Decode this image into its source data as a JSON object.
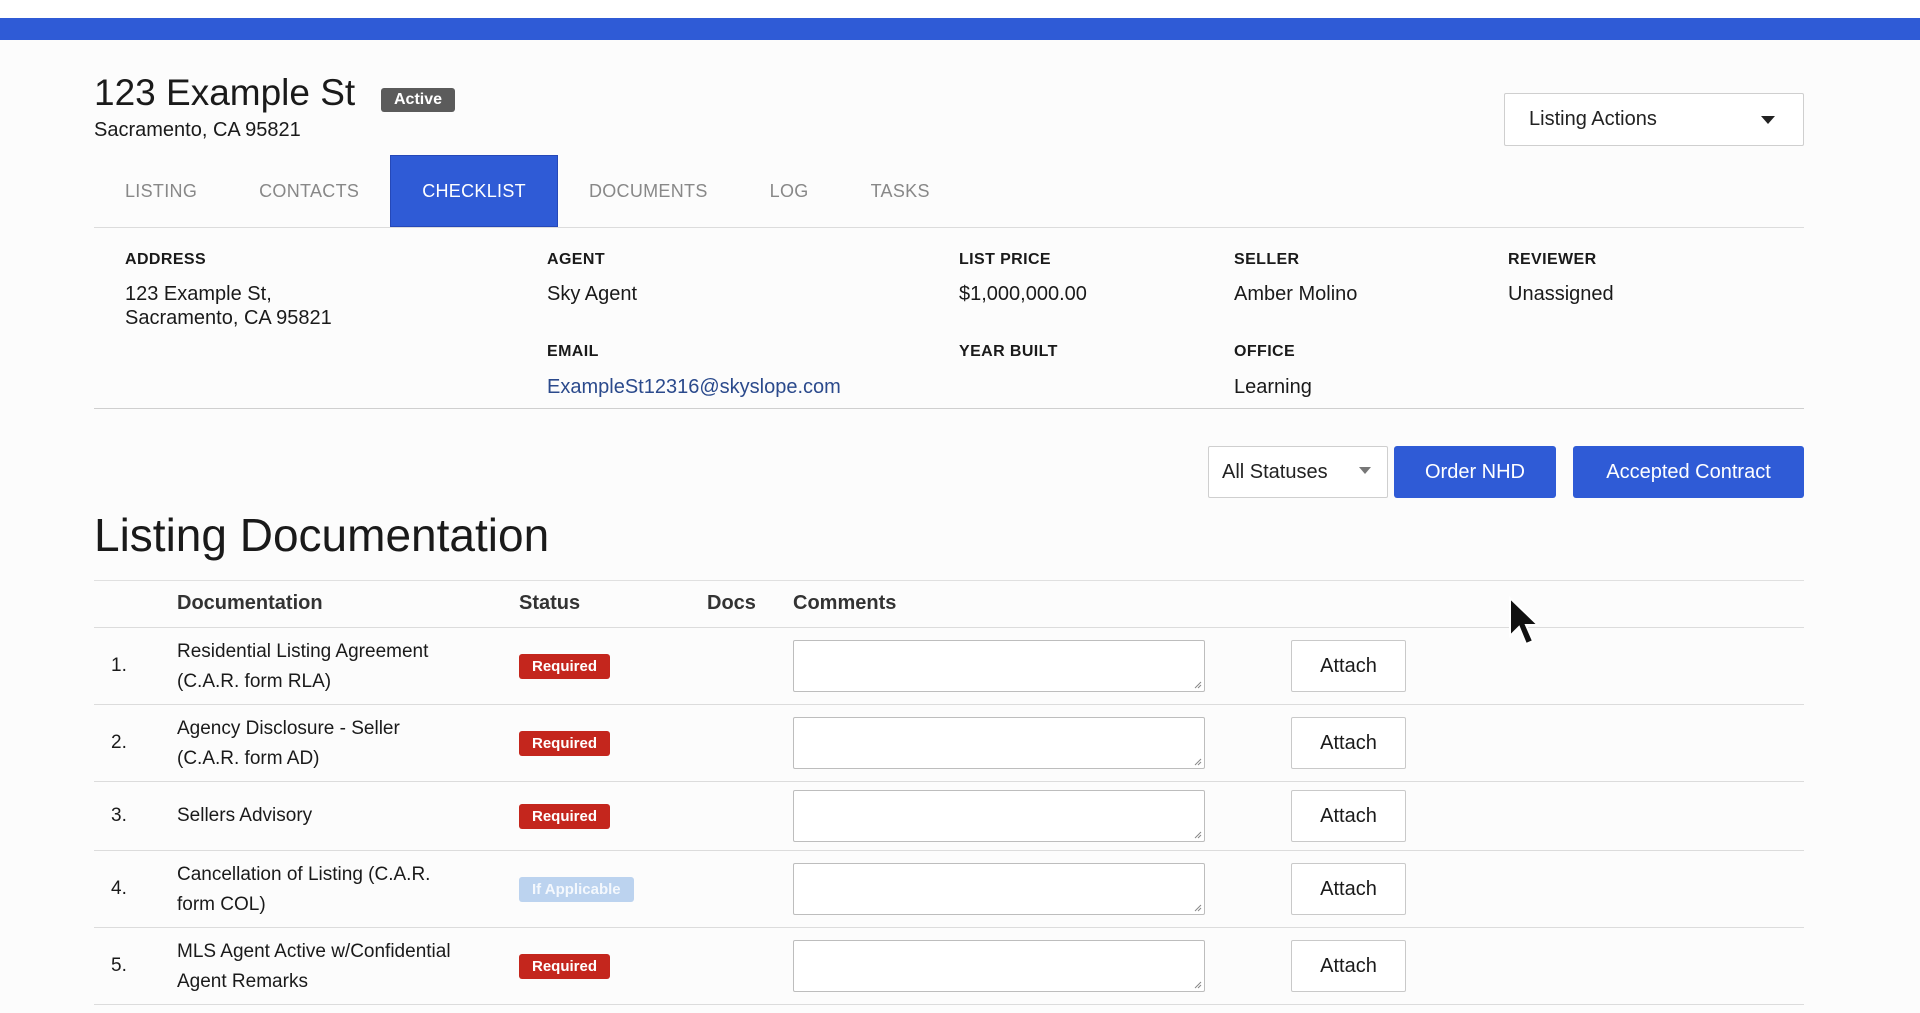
{
  "header": {
    "title": "123 Example St",
    "status_badge": "Active",
    "subaddress": "Sacramento, CA 95821",
    "actions_label": "Listing Actions"
  },
  "tabs": [
    {
      "label": "LISTING",
      "active": false
    },
    {
      "label": "CONTACTS",
      "active": false
    },
    {
      "label": "CHECKLIST",
      "active": true
    },
    {
      "label": "DOCUMENTS",
      "active": false
    },
    {
      "label": "LOG",
      "active": false
    },
    {
      "label": "TASKS",
      "active": false
    }
  ],
  "info": {
    "address_label": "ADDRESS",
    "address_line1": "123 Example St,",
    "address_line2": "Sacramento, CA 95821",
    "agent_label": "AGENT",
    "agent_value": "Sky Agent",
    "email_label": "EMAIL",
    "email_value": "ExampleSt12316@skyslope.com",
    "list_price_label": "LIST PRICE",
    "list_price_value": "$1,000,000.00",
    "year_built_label": "YEAR BUILT",
    "seller_label": "SELLER",
    "seller_value": "Amber Molino",
    "office_label": "OFFICE",
    "office_value": "Learning",
    "reviewer_label": "REVIEWER",
    "reviewer_value": "Unassigned"
  },
  "toolbar": {
    "status_filter": "All Statuses",
    "order_nhd": "Order NHD",
    "accepted_contract": "Accepted Contract"
  },
  "section_title": "Listing Documentation",
  "table": {
    "headers": {
      "documentation": "Documentation",
      "status": "Status",
      "docs": "Docs",
      "comments": "Comments"
    },
    "rows": [
      {
        "num": "1.",
        "doc_line1": "Residential Listing Agreement",
        "doc_line2": "(C.A.R. form RLA)",
        "status": "Required",
        "attach": "Attach"
      },
      {
        "num": "2.",
        "doc_line1": "Agency Disclosure - Seller",
        "doc_line2": "(C.A.R. form AD)",
        "status": "Required",
        "attach": "Attach"
      },
      {
        "num": "3.",
        "doc_line1": "Sellers Advisory",
        "doc_line2": "",
        "status": "Required",
        "attach": "Attach"
      },
      {
        "num": "4.",
        "doc_line1": "Cancellation of Listing (C.A.R.",
        "doc_line2": "form COL)",
        "status": "If Applicable",
        "attach": "Attach"
      },
      {
        "num": "5.",
        "doc_line1": "MLS Agent Active w/Confidential",
        "doc_line2": "Agent Remarks",
        "status": "Required",
        "attach": "Attach"
      }
    ]
  },
  "colors": {
    "accent": "#2f5bd6",
    "required": "#c4261d",
    "if_applicable": "#bcd3ef",
    "active_badge": "#5b5b5b"
  }
}
